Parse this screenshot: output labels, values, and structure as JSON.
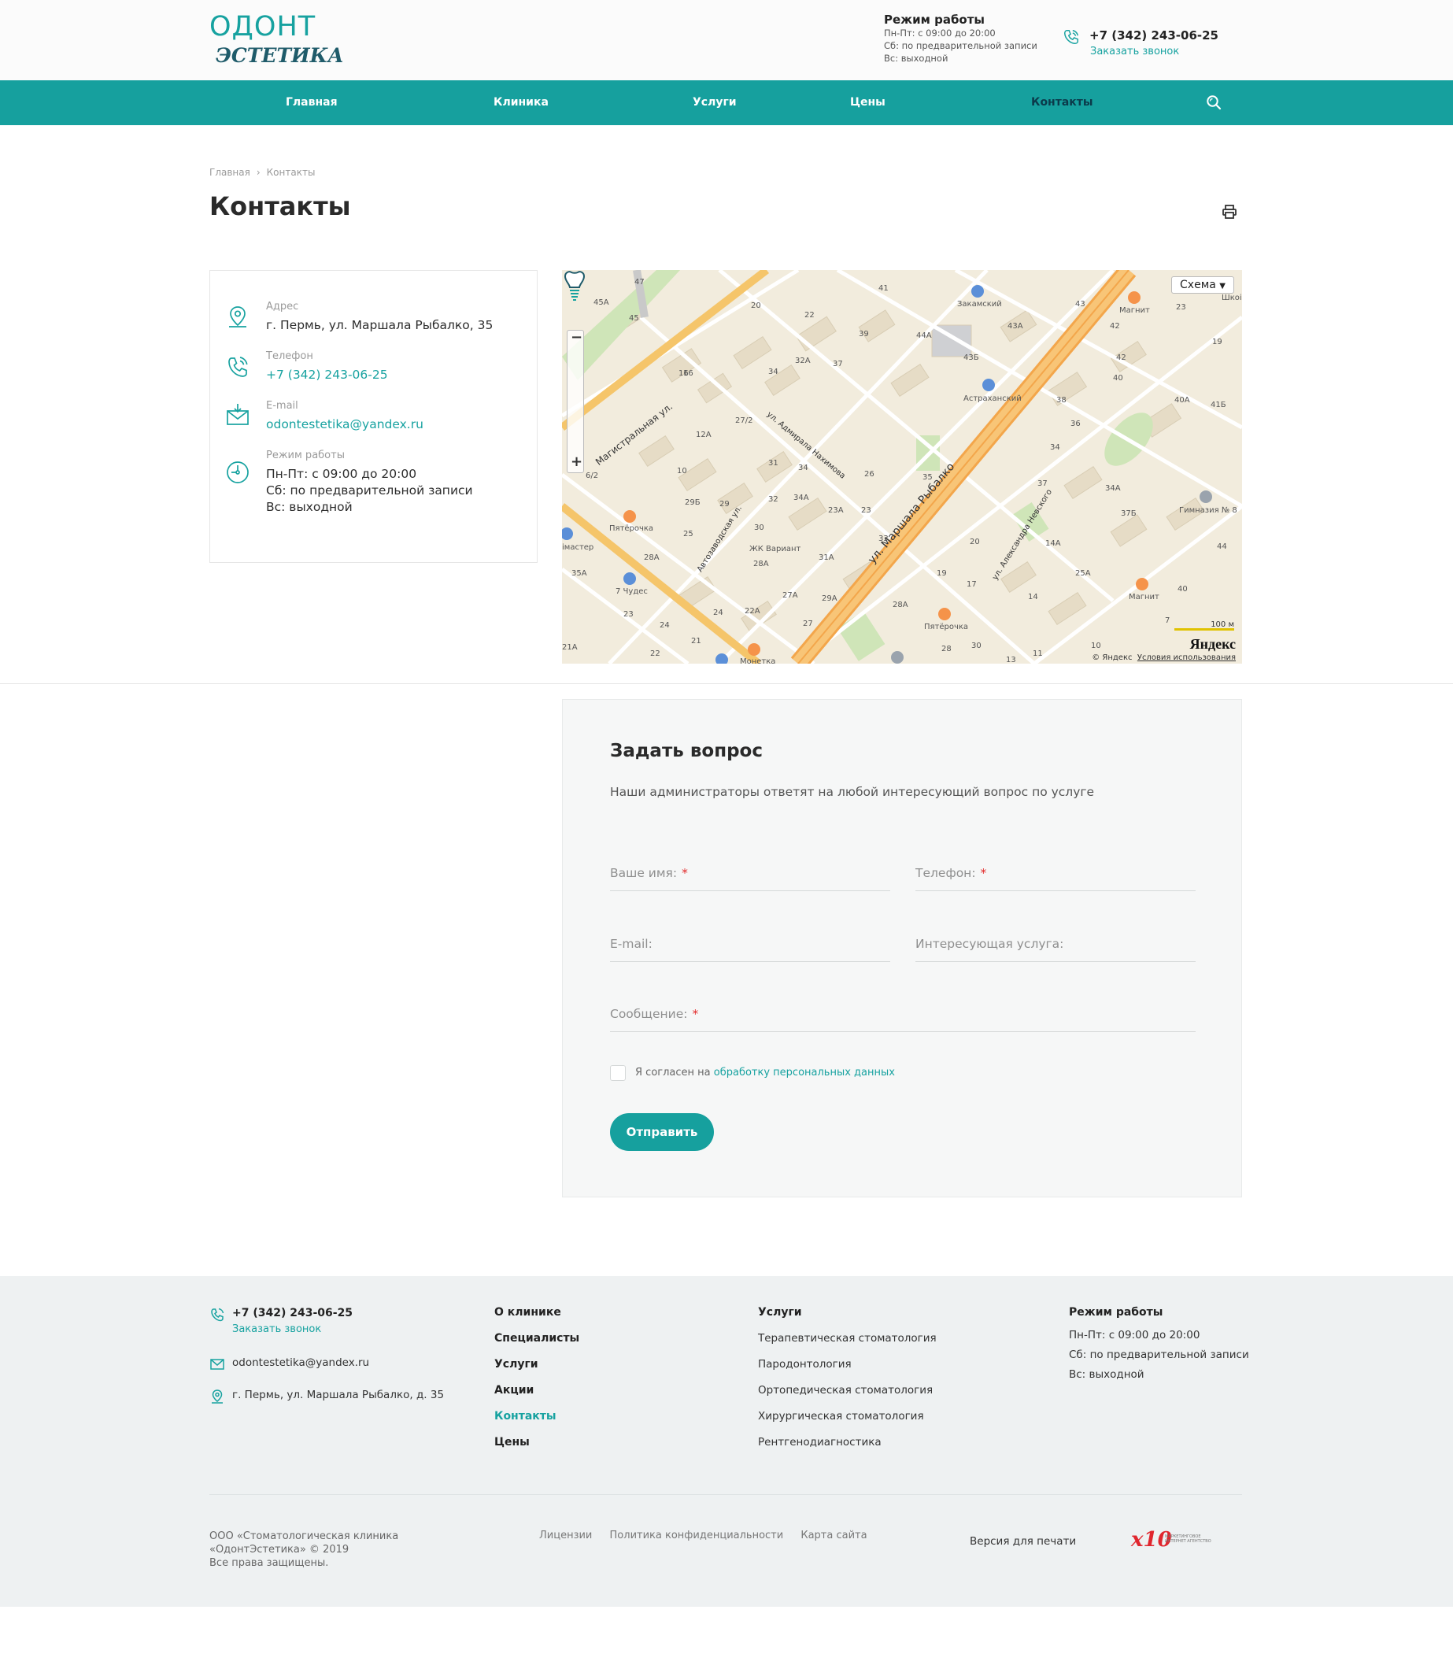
{
  "header": {
    "logo_line1": "ОДОНТ",
    "logo_line2": "ЭСТЕТИКА",
    "hours_title": "Режим работы",
    "hours_lines": [
      "Пн-Пт: с 09:00 до 20:00",
      "Сб: по предварительной записи",
      "Вс: выходной"
    ],
    "phone": "+7 (342) 243-06-25",
    "callback": "Заказать звонок"
  },
  "nav": {
    "items": [
      "Главная",
      "Клиника",
      "Услуги",
      "Цены",
      "Контакты"
    ],
    "active": "Контакты"
  },
  "breadcrumb": {
    "home": "Главная",
    "separator": "›",
    "current": "Контакты"
  },
  "page": {
    "title": "Контакты"
  },
  "contacts": {
    "address_label": "Адрес",
    "address": "г. Пермь, ул. Маршала Рыбалко, 35",
    "phone_label": "Телефон",
    "phone": "+7 (342) 243-06-25",
    "email_label": "E-mail",
    "email": "odontestetika@yandex.ru",
    "hours_label": "Режим работы",
    "hours": [
      "Пн-Пт: с 09:00 до 20:00",
      "Сб: по предварительной записи",
      "Вс: выходной"
    ]
  },
  "map": {
    "scheme_button": "Схема",
    "street_main": "ул. Маршала Рыбалко",
    "street_2": "Магистральная ул.",
    "street_3": "ул. Адмирала Нахимова",
    "street_4": "Автозаводская ул.",
    "street_5": "ул. Александра Невского",
    "poi": [
      "Закамский",
      "Магнит",
      "Астраханский",
      "Гимназия № 8",
      "Пятёрочка",
      "7 Чудес",
      "ЖК Вариант",
      "Пятёрочка",
      "Магнит",
      "Монетка",
      "Шкоі",
      "імастер"
    ],
    "houses": [
      "47",
      "41",
      "45A",
      "45",
      "20",
      "22",
      "39",
      "44A",
      "43A",
      "43",
      "42",
      "43Б",
      "40",
      "40A",
      "41Б",
      "38",
      "36",
      "34",
      "34A",
      "37Б",
      "37",
      "44",
      "40",
      "33",
      "35",
      "27/2",
      "32A",
      "34",
      "37",
      "12A",
      "16",
      "31",
      "34",
      "29Б",
      "29",
      "30",
      "32",
      "34A",
      "23A",
      "23",
      "26",
      "28A",
      "28A",
      "25",
      "28A",
      "24",
      "22A",
      "27A",
      "29A",
      "31A",
      "21",
      "35A",
      "23",
      "21A",
      "24",
      "22",
      "27",
      "28",
      "30",
      "13",
      "11",
      "10",
      "7",
      "25A",
      "14A",
      "14",
      "20",
      "19",
      "17",
      "19",
      "23",
      "42",
      "10",
      "6/2",
      "16"
    ],
    "zoom_plus": "+",
    "zoom_minus": "−",
    "scale": "100 м",
    "brand": "Яндекс",
    "copyright": "© Яндекс",
    "terms": "Условия использования"
  },
  "form": {
    "title": "Задать вопрос",
    "subtitle": "Наши администраторы ответят на любой интересующий вопрос по услуге",
    "name_label": "Ваше имя:",
    "phone_label": "Телефон:",
    "email_label": "E-mail:",
    "service_label": "Интересующая услуга:",
    "message_label": "Сообщение:",
    "required_mark": "*",
    "consent_text": "Я согласен на",
    "consent_link": "обработку персональных данных",
    "submit": "Отправить"
  },
  "footer": {
    "phone": "+7 (342) 243-06-25",
    "callback": "Заказать звонок",
    "email": "odontestetika@yandex.ru",
    "address": "г. Пермь, ул. Маршала Рыбалко, д. 35",
    "menu": [
      "О клинике",
      "Специалисты",
      "Услуги",
      "Акции",
      "Контакты",
      "Цены"
    ],
    "menu_active": "Контакты",
    "services_title": "Услуги",
    "services": [
      "Терапевтическая стоматология",
      "Пародонтология",
      "Ортопедическая стоматология",
      "Хирургическая стоматология",
      "Рентгенодиагностика"
    ],
    "hours_title": "Режим работы",
    "hours": [
      "Пн-Пт: с 09:00 до 20:00",
      "Сб: по предварительной записи",
      "Вс: выходной"
    ],
    "copyright": [
      "ООО «Стоматологическая клиника",
      "«ОдонтЭстетика» © 2019",
      "Все права защищены."
    ],
    "links": [
      "Лицензии",
      "Политика конфиденциальности",
      "Карта сайта"
    ],
    "print_version": "Версия для печати",
    "agency_logo": "x10",
    "agency_text": "МАРКЕТИНГОВОЕ ИНТЕРНЕТ АГЕНТСТВО"
  },
  "colors": {
    "accent": "#16a09e",
    "dark": "#0b3a4a",
    "required": "#e22b2b"
  }
}
